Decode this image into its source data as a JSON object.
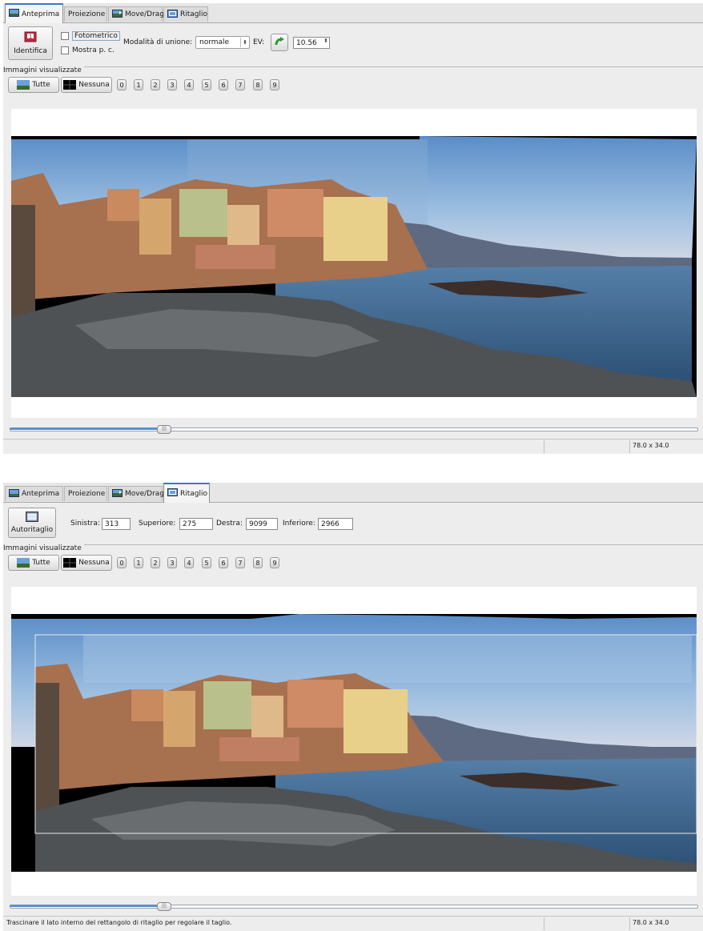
{
  "tabs": [
    {
      "label": "Anteprima",
      "icon": "preview-icon"
    },
    {
      "label": "Proiezione",
      "icon": ""
    },
    {
      "label": "Move/Drag",
      "icon": "move-icon"
    },
    {
      "label": "Ritaglio",
      "icon": "crop-icon"
    }
  ],
  "panel_top": {
    "active_tab": "Anteprima",
    "identify_label": "Identifica",
    "photometric_label": "Fotometrico",
    "show_cp_label": "Mostra p. c.",
    "blend_mode_label": "Modalità di unione:",
    "blend_mode_value": "normale",
    "ev_label": "EV:",
    "ev_value": "10.56",
    "photometric_checked": false,
    "show_cp_checked": false
  },
  "panel_bottom": {
    "active_tab": "Ritaglio",
    "autocrop_label": "Autoritaglio",
    "left_label": "Sinistra:",
    "left_value": "313",
    "top_label": "Superiore:",
    "top_value": "275",
    "right_label": "Destra:",
    "right_value": "9099",
    "bottom_label": "Inferiore:",
    "bottom_value": "2966"
  },
  "displayed_images": {
    "title": "Immagini visualizzate",
    "all_label": "Tutte",
    "none_label": "Nessuna",
    "numbers": [
      "0",
      "1",
      "2",
      "3",
      "4",
      "5",
      "6",
      "7",
      "8",
      "9"
    ]
  },
  "status_top": {
    "message": "",
    "dimensions": "78.0 x 34.0"
  },
  "status_bottom": {
    "message": "Trascinare il lato interno del rettangolo di ritaglio per regolare il taglio.",
    "dimensions": "78.0 x 34.0"
  },
  "colors": {
    "accent": "#3c78c8",
    "sky": "#7fb0e0",
    "sea": "#3d6a95",
    "rocks": "#56595c"
  },
  "zoom_slider_fraction": 0.22
}
